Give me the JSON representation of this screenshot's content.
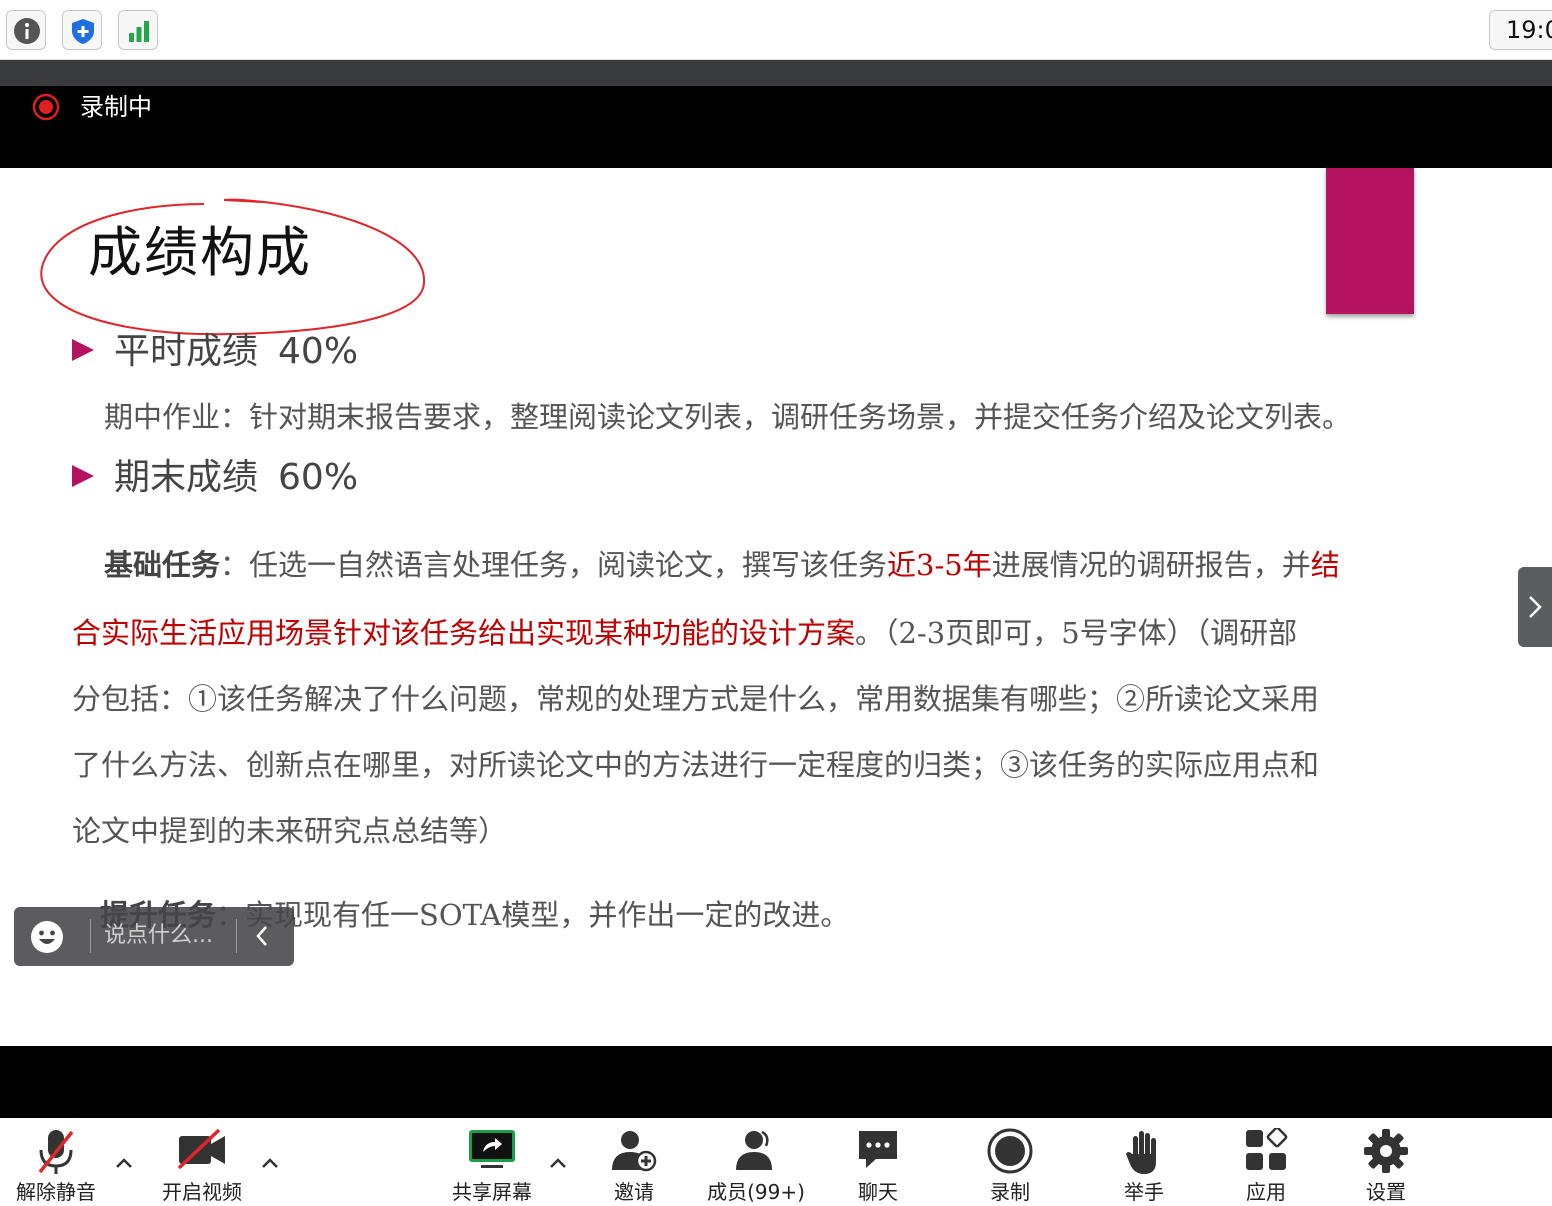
{
  "status_bar": {
    "icons": [
      "info-icon",
      "shield-icon",
      "signal-bars-icon"
    ],
    "clock": "19:0"
  },
  "recording": {
    "label": "录制中",
    "color": "#e02020"
  },
  "slide": {
    "title": "成绩构成",
    "accent_color": "#b5135f",
    "bullets": [
      {
        "label": "平时成绩",
        "percent": "40%"
      },
      {
        "label": "期末成绩",
        "percent": "60%"
      }
    ],
    "midterm": {
      "label": "期中作业：",
      "text": "针对期末报告要求，整理阅读论文列表，调研任务场景，并提交任务介绍及论文列表。"
    },
    "basic_task": {
      "label": "基础任务",
      "colon": "：",
      "line1_a": "任选一自然语言处理任务，阅读论文，撰写该任务",
      "line1_red": "近3-5年",
      "line1_b": "进展情况的调研报告，并",
      "line1_red2": "结",
      "line2_red": "合实际生活应用场景针对该任务给出实现某种功能的设计方案",
      "line2_b": "。（2-3页即可，5号字体）（调研部",
      "line3": "分包括：①该任务解决了什么问题，常规的处理方式是什么，常用数据集有哪些；②所读论文采用",
      "line4": "了什么方法、创新点在哪里，对所读论文中的方法进行一定程度的归类；③该任务的实际应用点和",
      "line5": "论文中提到的未来研究点总结等）"
    },
    "advanced_task": {
      "label": "提升任务",
      "colon": "：",
      "text": "实现现有任一SOTA模型，并作出一定的改进。"
    }
  },
  "chat": {
    "placeholder": "说点什么..."
  },
  "toolbar": {
    "unmute": "解除静音",
    "start_video": "开启视频",
    "share_screen": "共享屏幕",
    "invite": "邀请",
    "members": "成员(99+)",
    "chat": "聊天",
    "record": "录制",
    "raise_hand": "举手",
    "apps": "应用",
    "settings": "设置",
    "share_color": "#1a9e4a"
  }
}
